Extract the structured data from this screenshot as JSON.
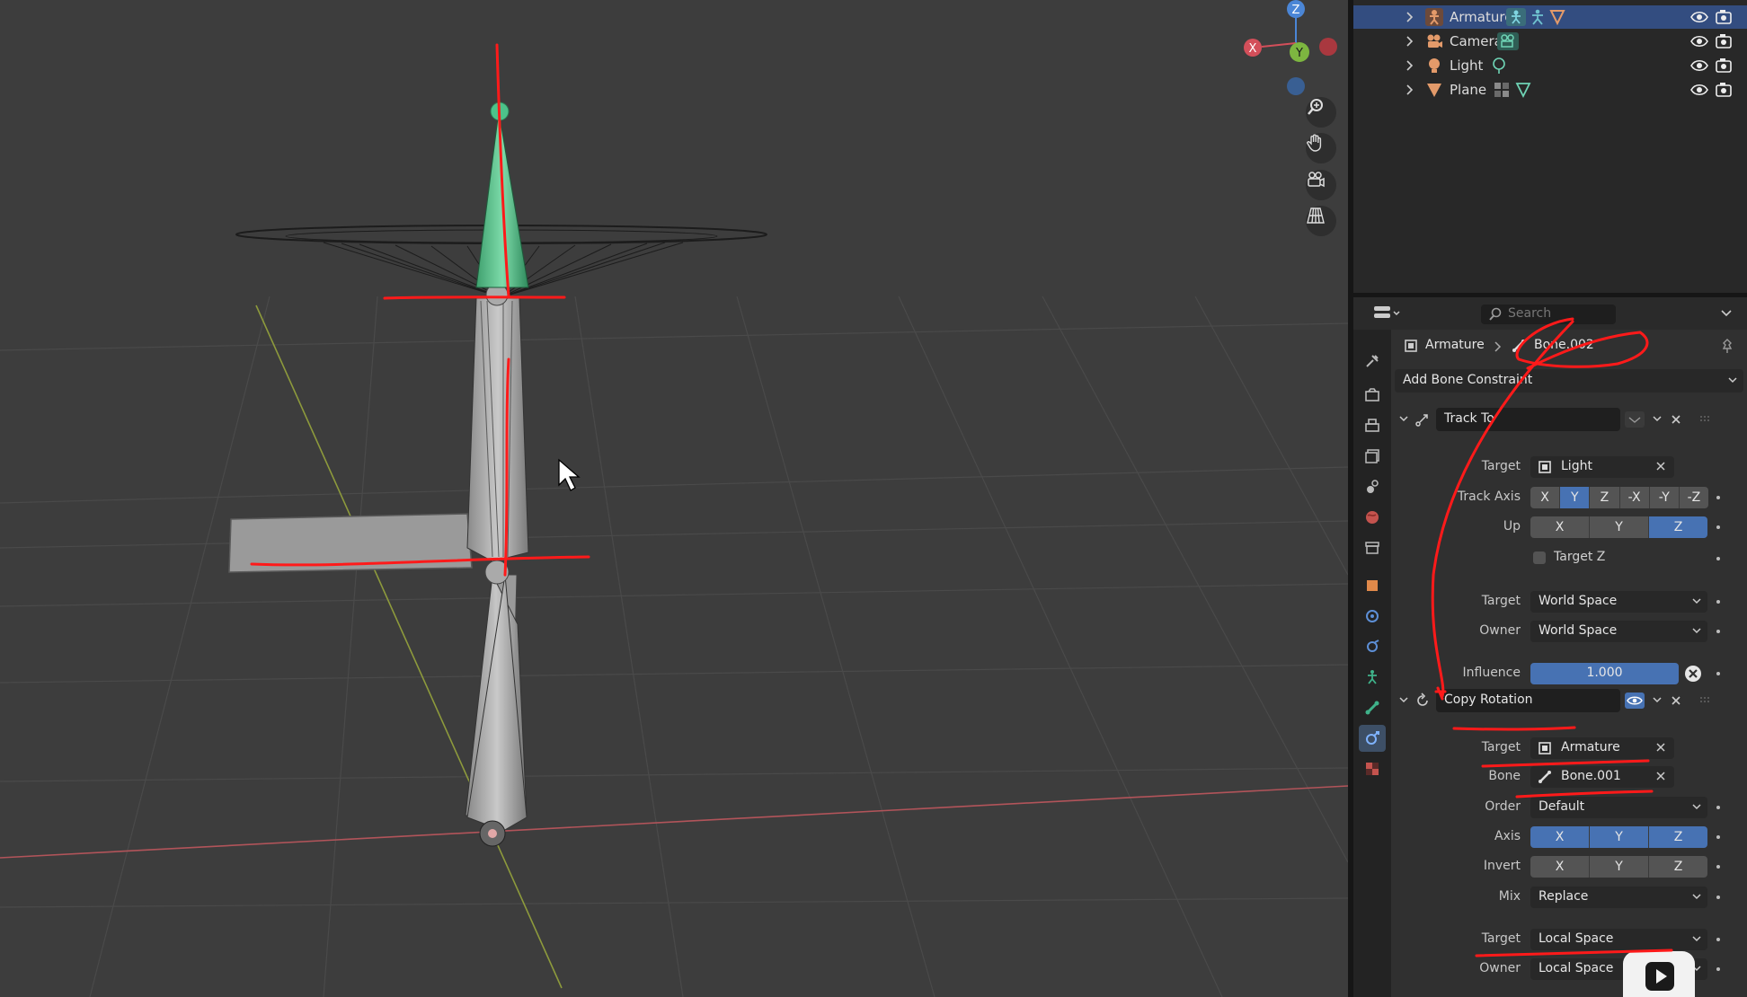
{
  "outliner": {
    "items": [
      {
        "name": "Armature",
        "selected": true
      },
      {
        "name": "Camera",
        "selected": false
      },
      {
        "name": "Light",
        "selected": false
      },
      {
        "name": "Plane",
        "selected": false
      }
    ]
  },
  "gizmo": {
    "z": "Z",
    "y": "Y",
    "x": "X"
  },
  "properties": {
    "search_placeholder": "Search",
    "breadcrumb": {
      "object": "Armature",
      "bone": "Bone.002"
    },
    "add_constraint": "Add Bone Constraint",
    "track_to": {
      "name": "Track To",
      "target_label": "Target",
      "target_value": "Light",
      "track_axis_label": "Track Axis",
      "track_axis_options": [
        "X",
        "Y",
        "Z",
        "-X",
        "-Y",
        "-Z"
      ],
      "track_axis_selected": "Y",
      "up_label": "Up",
      "up_options": [
        "X",
        "Y",
        "Z"
      ],
      "up_selected": "Z",
      "target_z_label": "Target Z",
      "target_space_label": "Target",
      "target_space_value": "World Space",
      "owner_space_label": "Owner",
      "owner_space_value": "World Space",
      "influence_label": "Influence",
      "influence_value": "1.000"
    },
    "copy_rotation": {
      "name": "Copy Rotation",
      "target_label": "Target",
      "target_value": "Armature",
      "bone_label": "Bone",
      "bone_value": "Bone.001",
      "order_label": "Order",
      "order_value": "Default",
      "axis_label": "Axis",
      "axis_options": [
        "X",
        "Y",
        "Z"
      ],
      "invert_label": "Invert",
      "invert_options": [
        "X",
        "Y",
        "Z"
      ],
      "mix_label": "Mix",
      "mix_value": "Replace",
      "target_space_label": "Target",
      "target_space_value": "Local Space",
      "owner_space_label": "Owner",
      "owner_space_value": "Local Space"
    }
  },
  "colors": {
    "selection": "#334d80",
    "toggle_on": "#4772b3",
    "annotation": "#ff1a1a",
    "bone_active": "#4dc28a"
  }
}
